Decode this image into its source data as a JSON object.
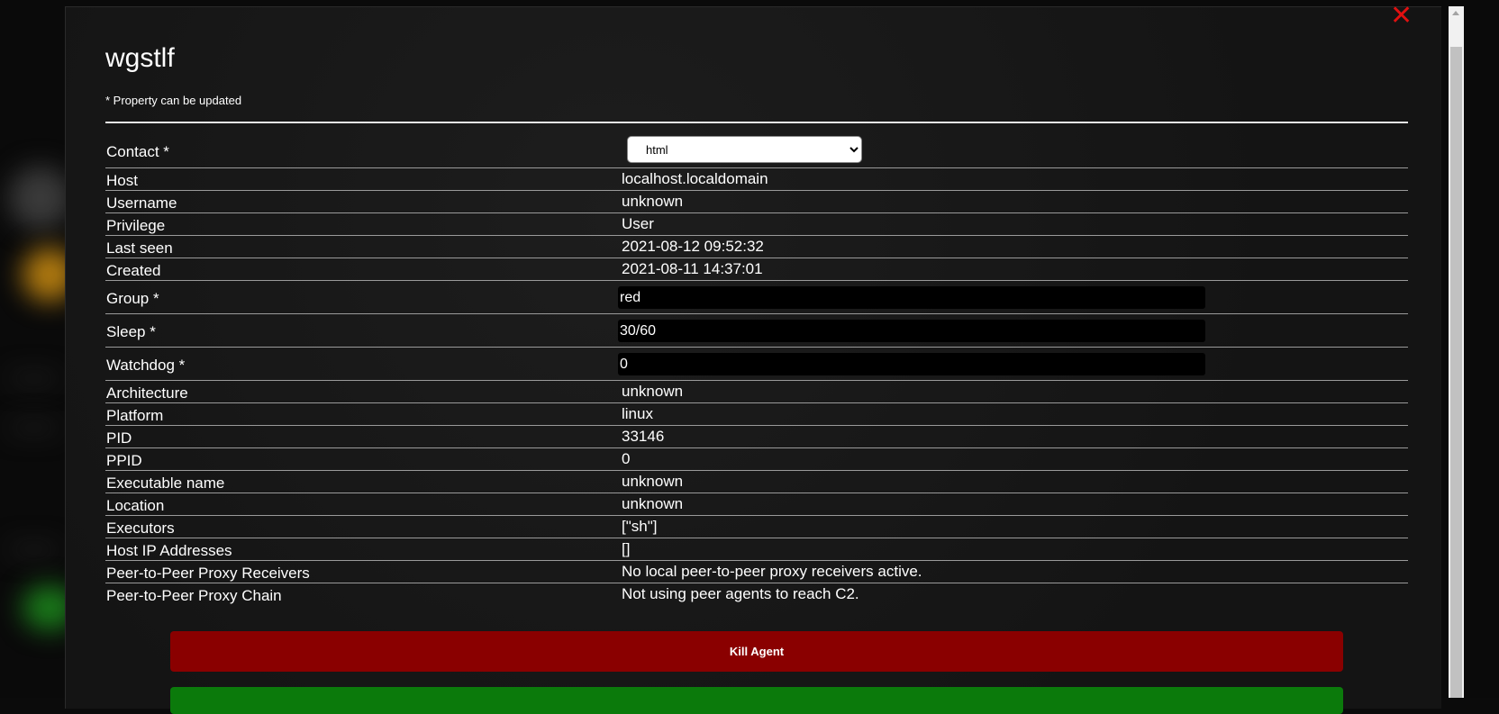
{
  "modal": {
    "title": "wgstlf",
    "note": "* Property can be updated"
  },
  "fields": {
    "contact": {
      "label": "Contact *",
      "selected": "html",
      "options": [
        "html"
      ]
    },
    "host": {
      "label": "Host",
      "value": "localhost.localdomain"
    },
    "username": {
      "label": "Username",
      "value": "unknown"
    },
    "privilege": {
      "label": "Privilege",
      "value": "User"
    },
    "last_seen": {
      "label": "Last seen",
      "value": "2021-08-12 09:52:32"
    },
    "created": {
      "label": "Created",
      "value": "2021-08-11 14:37:01"
    },
    "group": {
      "label": "Group *",
      "value": "red"
    },
    "sleep": {
      "label": "Sleep *",
      "value": "30/60"
    },
    "watchdog": {
      "label": "Watchdog *",
      "value": "0"
    },
    "architecture": {
      "label": "Architecture",
      "value": "unknown"
    },
    "platform": {
      "label": "Platform",
      "value": "linux"
    },
    "pid": {
      "label": "PID",
      "value": "33146"
    },
    "ppid": {
      "label": "PPID",
      "value": "0"
    },
    "exe_name": {
      "label": "Executable name",
      "value": "unknown"
    },
    "location": {
      "label": "Location",
      "value": "unknown"
    },
    "executors": {
      "label": "Executors",
      "value": "[\"sh\"]"
    },
    "host_ips": {
      "label": "Host IP Addresses",
      "value": "[]"
    },
    "p2p_receivers": {
      "label": "Peer-to-Peer Proxy Receivers",
      "value": "No local peer-to-peer proxy receivers active."
    },
    "p2p_chain": {
      "label": "Peer-to-Peer Proxy Chain",
      "value": "Not using peer agents to reach C2."
    }
  },
  "buttons": {
    "kill_label": "Kill Agent"
  },
  "icons": {
    "close": "close-icon"
  },
  "colors": {
    "close": "#e01010",
    "kill": "#8a0000",
    "green_button": "#0b7a0b"
  }
}
